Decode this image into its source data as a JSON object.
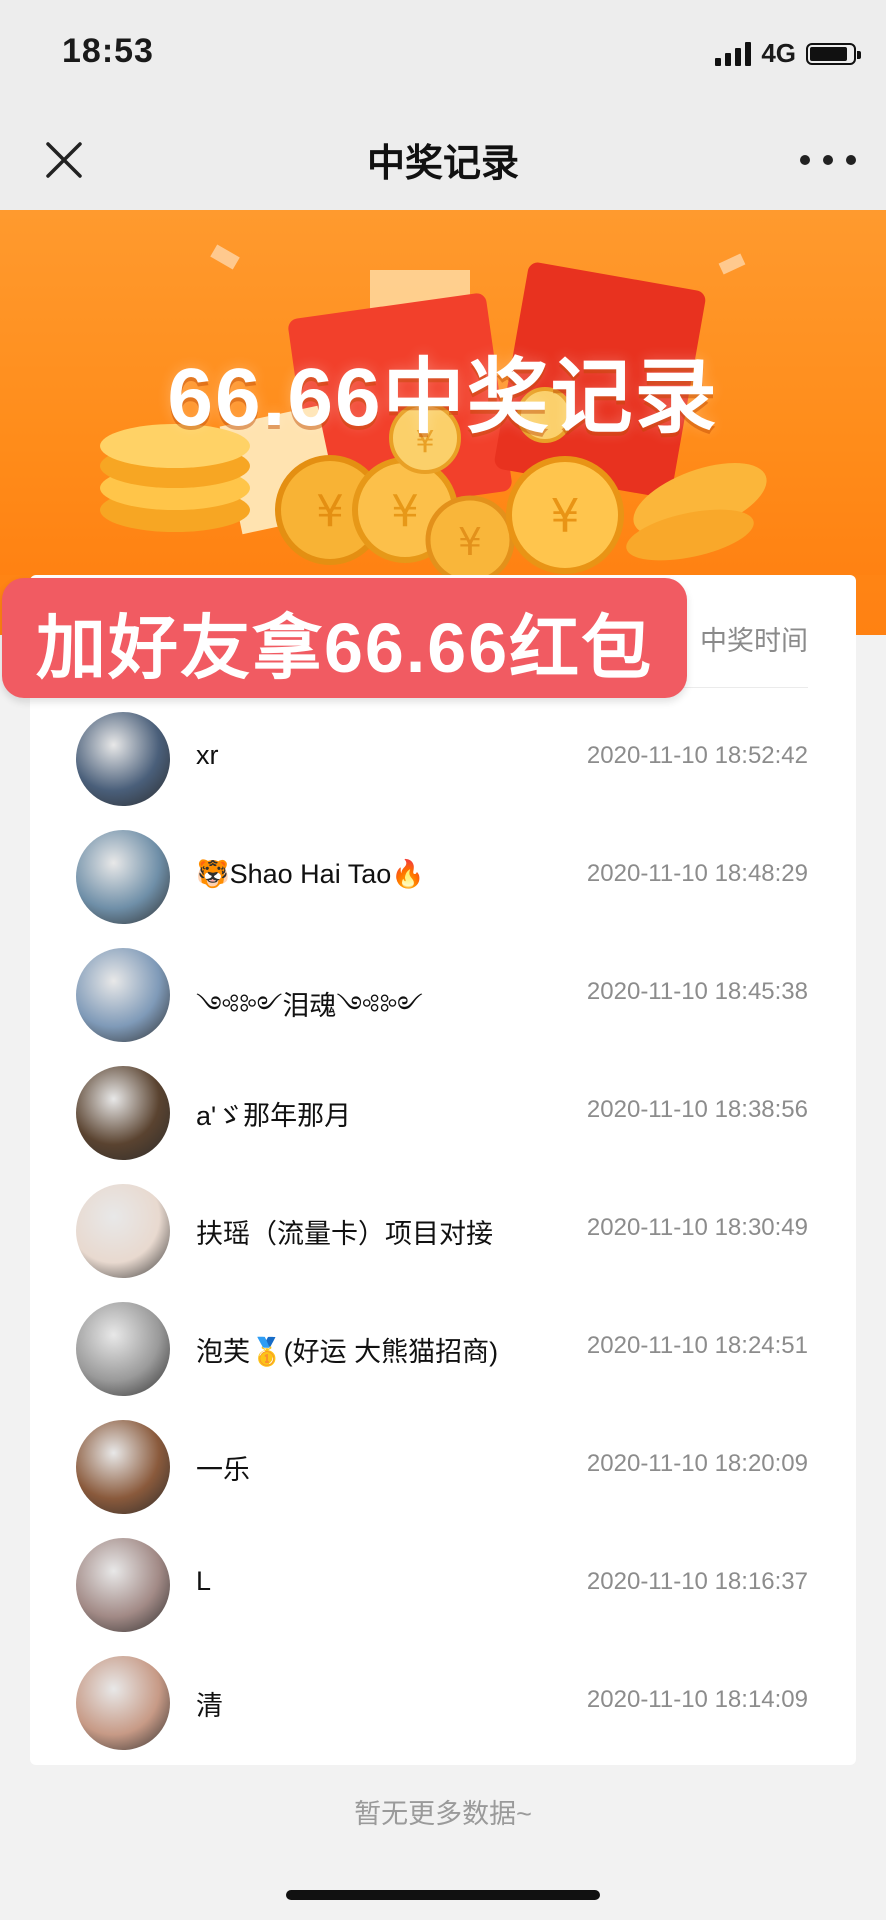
{
  "status_bar": {
    "time": "18:53",
    "network": "4G",
    "battery_level": 0.88
  },
  "nav": {
    "title": "中奖记录",
    "close_icon": "close-icon",
    "more_icon": "more-dots-icon"
  },
  "banner": {
    "title": "66.66中奖记录"
  },
  "promo": {
    "text": "加好友拿66.66红包"
  },
  "list": {
    "time_header": "中奖时间",
    "rows": [
      {
        "name": "xr",
        "time": "2020-11-10 18:52:42",
        "avatar_color": "#4a5f7a"
      },
      {
        "name": "🐯Shao Hai Tao🔥",
        "time": "2020-11-10 18:48:29",
        "avatar_color": "#6f8fa8"
      },
      {
        "name": "༺༻泪魂༺༻",
        "time": "2020-11-10 18:45:38",
        "avatar_color": "#7f9ab8"
      },
      {
        "name": "a'ゞ那年那月",
        "time": "2020-11-10 18:38:56",
        "avatar_color": "#5a4330"
      },
      {
        "name": "扶瑶（流量卡）项目对接",
        "time": "2020-11-10 18:30:49",
        "avatar_color": "#e8d9cf"
      },
      {
        "name": "泡芙🥇(好运 大熊猫招商)",
        "time": "2020-11-10 18:24:51",
        "avatar_color": "#9a9a9a"
      },
      {
        "name": "一乐",
        "time": "2020-11-10 18:20:09",
        "avatar_color": "#8a5a3c"
      },
      {
        "name": "L",
        "time": "2020-11-10 18:16:37",
        "avatar_color": "#a28a86"
      },
      {
        "name": "清",
        "time": "2020-11-10 18:14:09",
        "avatar_color": "#c79a86"
      }
    ]
  },
  "footer": {
    "no_more": "暂无更多数据~"
  }
}
